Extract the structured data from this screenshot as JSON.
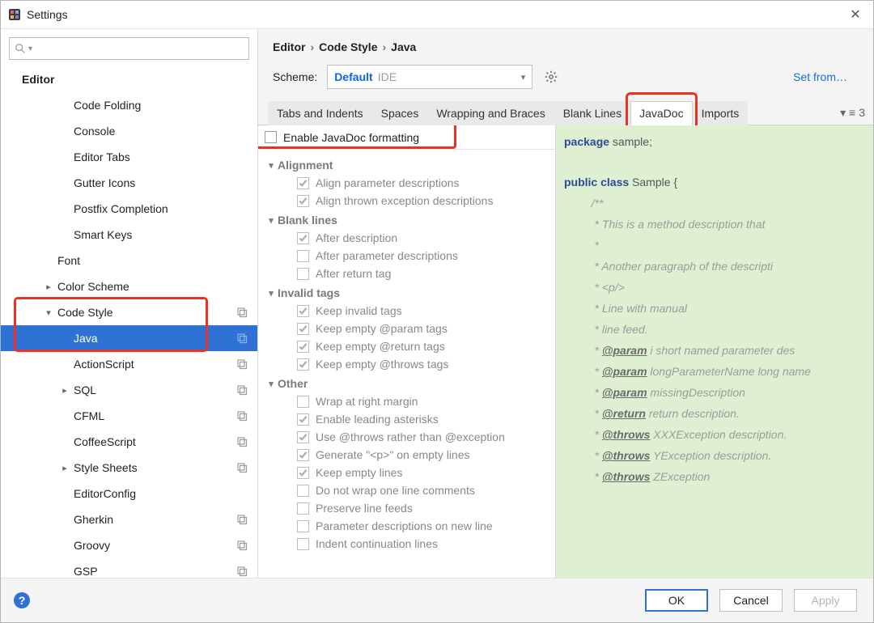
{
  "window": {
    "title": "Settings"
  },
  "search": {
    "placeholder": ""
  },
  "sidebar": {
    "heading": "Editor",
    "items": [
      {
        "label": "Code Folding",
        "level": 2
      },
      {
        "label": "Console",
        "level": 2
      },
      {
        "label": "Editor Tabs",
        "level": 2
      },
      {
        "label": "Gutter Icons",
        "level": 2
      },
      {
        "label": "Postfix Completion",
        "level": 2
      },
      {
        "label": "Smart Keys",
        "level": 2
      },
      {
        "label": "Font",
        "level": 1
      },
      {
        "label": "Color Scheme",
        "level": 1,
        "chev": "right"
      },
      {
        "label": "Code Style",
        "level": 1,
        "chev": "down",
        "copy": true
      },
      {
        "label": "Java",
        "level": 2,
        "selected": true,
        "copy": true
      },
      {
        "label": "ActionScript",
        "level": 2,
        "copy": true
      },
      {
        "label": "SQL",
        "level": 2,
        "chev": "right",
        "copy": true
      },
      {
        "label": "CFML",
        "level": 2,
        "copy": true
      },
      {
        "label": "CoffeeScript",
        "level": 2,
        "copy": true
      },
      {
        "label": "Style Sheets",
        "level": 2,
        "chev": "right",
        "copy": true
      },
      {
        "label": "EditorConfig",
        "level": 2
      },
      {
        "label": "Gherkin",
        "level": 2,
        "copy": true
      },
      {
        "label": "Groovy",
        "level": 2,
        "copy": true
      },
      {
        "label": "GSP",
        "level": 2,
        "copy": true
      }
    ]
  },
  "breadcrumb": {
    "a": "Editor",
    "b": "Code Style",
    "c": "Java"
  },
  "scheme": {
    "label": "Scheme:",
    "name": "Default",
    "suffix": "IDE",
    "setfrom": "Set from…"
  },
  "tabs": {
    "items": [
      "Tabs and Indents",
      "Spaces",
      "Wrapping and Braces",
      "Blank Lines",
      "JavaDoc",
      "Imports"
    ],
    "activeIndex": 4,
    "right": "3"
  },
  "enable": {
    "label": "Enable JavaDoc formatting"
  },
  "groups": [
    {
      "name": "Alignment",
      "options": [
        {
          "label": "Align parameter descriptions",
          "checked": true
        },
        {
          "label": "Align thrown exception descriptions",
          "checked": true
        }
      ]
    },
    {
      "name": "Blank lines",
      "options": [
        {
          "label": "After description",
          "checked": true
        },
        {
          "label": "After parameter descriptions",
          "checked": false
        },
        {
          "label": "After return tag",
          "checked": false
        }
      ]
    },
    {
      "name": "Invalid tags",
      "options": [
        {
          "label": "Keep invalid tags",
          "checked": true
        },
        {
          "label": "Keep empty @param tags",
          "checked": true
        },
        {
          "label": "Keep empty @return tags",
          "checked": true
        },
        {
          "label": "Keep empty @throws tags",
          "checked": true
        }
      ]
    },
    {
      "name": "Other",
      "options": [
        {
          "label": "Wrap at right margin",
          "checked": false
        },
        {
          "label": "Enable leading asterisks",
          "checked": true
        },
        {
          "label": "Use @throws rather than @exception",
          "checked": true
        },
        {
          "label": "Generate \"<p>\" on empty lines",
          "checked": true
        },
        {
          "label": "Keep empty lines",
          "checked": true
        },
        {
          "label": "Do not wrap one line comments",
          "checked": false
        },
        {
          "label": "Preserve line feeds",
          "checked": false
        },
        {
          "label": "Parameter descriptions on new line",
          "checked": false
        },
        {
          "label": "Indent continuation lines",
          "checked": false
        }
      ]
    }
  ],
  "preview": {
    "l1a": "package",
    "l1b": " sample;",
    "l2a": "public class",
    "l2b": " Sample {",
    "c01": "/**",
    "c02": " * This is a method description that",
    "c03": " *",
    "c04": " * Another paragraph of the descripti",
    "c05": " * <p/>",
    "c06": " * Line with manual",
    "c07": " * line feed.",
    "c08": " i short named parameter des",
    "c09": " longParameterName long name",
    "c10": " missingDescription",
    "c11": " return description.",
    "c12": " XXXException description.",
    "c13": " YException description.",
    "c14": " ZException",
    "tag_param": "@param",
    "tag_return": "@return",
    "tag_throws": "@throws"
  },
  "buttons": {
    "ok": "OK",
    "cancel": "Cancel",
    "apply": "Apply"
  }
}
